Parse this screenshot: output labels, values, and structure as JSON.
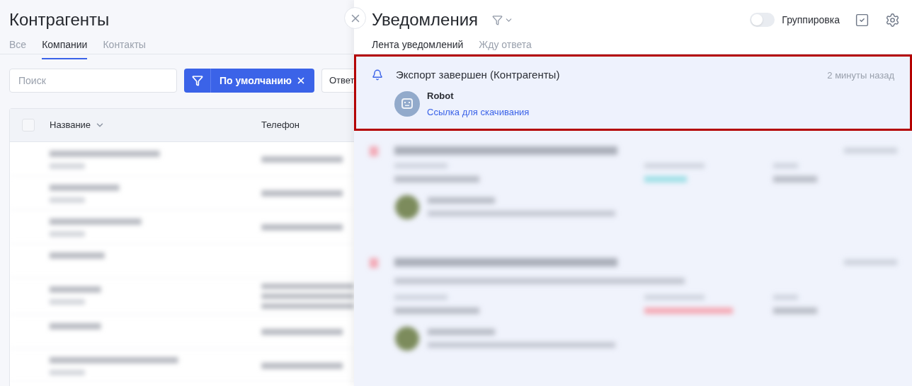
{
  "contractors": {
    "title": "Контрагенты",
    "tabs": [
      {
        "label": "Все",
        "selected": false
      },
      {
        "label": "Компании",
        "selected": true
      },
      {
        "label": "Контакты",
        "selected": false
      }
    ],
    "search": {
      "placeholder": "Поиск"
    },
    "filter": {
      "label": "По умолчанию"
    },
    "next_button": "Ответ",
    "table": {
      "select_all": {
        "checked": false
      },
      "columns": [
        "Название",
        "Телефон"
      ]
    }
  },
  "notifications": {
    "title": "Уведомления",
    "grouping": {
      "label": "Группировка",
      "on": false
    },
    "tabs": [
      {
        "label": "Лента уведомлений",
        "selected": true
      },
      {
        "label": "Жду ответа",
        "selected": false
      }
    ],
    "items": [
      {
        "title": "Экспорт завершен (Контрагенты)",
        "time": "2 минуты назад",
        "author": "Robot",
        "link": "Ссылка для скачивания",
        "highlighted": true
      }
    ]
  }
}
